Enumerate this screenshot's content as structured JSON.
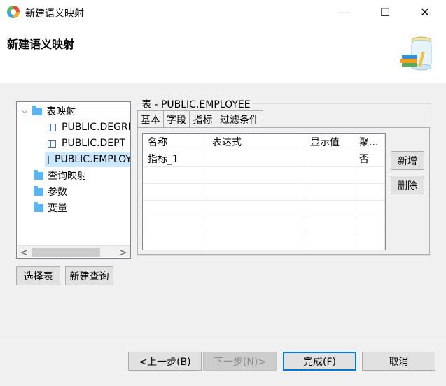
{
  "window": {
    "title": "新建语义映射",
    "controls": {
      "minimize": "—",
      "maximize": "☐",
      "close": "✕"
    }
  },
  "header": {
    "title": "新建语义映射"
  },
  "tree": {
    "nodes": [
      {
        "label": "表映射",
        "expanded": true
      },
      {
        "label": "PUBLIC.DEGREE"
      },
      {
        "label": "PUBLIC.DEPT"
      },
      {
        "label": "PUBLIC.EMPLOYEE",
        "selected": true
      },
      {
        "label": "查询映射"
      },
      {
        "label": "参数"
      },
      {
        "label": "变量"
      }
    ]
  },
  "left_buttons": {
    "select_table": "选择表",
    "new_query": "新建查询"
  },
  "group": {
    "label": "表 - PUBLIC.EMPLOYEE",
    "tabs": [
      "基本",
      "字段",
      "指标",
      "过滤条件"
    ],
    "active_tab": 2
  },
  "grid": {
    "columns": [
      "名称",
      "表达式",
      "显示值",
      "聚..."
    ],
    "rows": [
      [
        "指标_1",
        "",
        "",
        "否"
      ]
    ]
  },
  "side_buttons": {
    "add": "新增",
    "delete": "删除"
  },
  "footer": {
    "prev": "<上一步(B)",
    "next": "下一步(N)>",
    "finish": "完成(F)",
    "cancel": "取消"
  }
}
